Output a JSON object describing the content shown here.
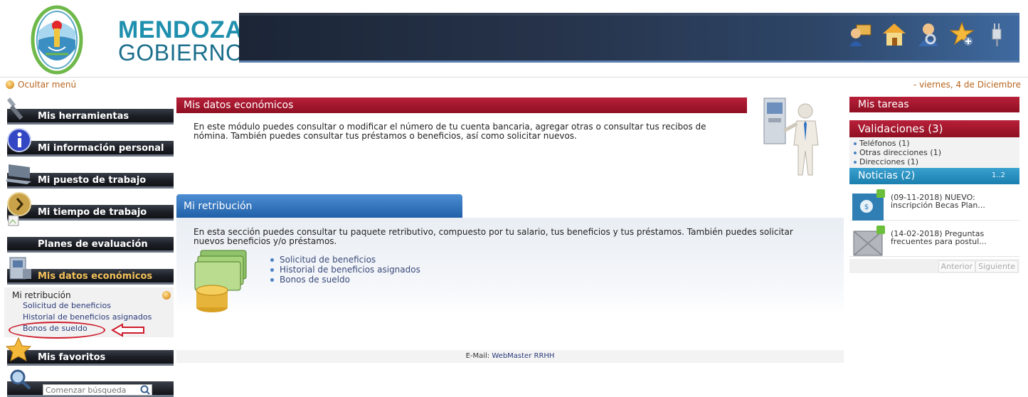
{
  "header": {
    "logo_line1": "MENDOZA",
    "logo_line2": "GOBIERNO",
    "icons": [
      "user-card-icon",
      "home-icon",
      "user-search-icon",
      "favorite-star-icon",
      "logout-plug-icon"
    ]
  },
  "topbar": {
    "hide_menu": "Ocultar menú",
    "date": "- viernes, 4 de Diciembre"
  },
  "sidebar": {
    "items": [
      {
        "label": "Mis herramientas",
        "icon": "wrench-icon"
      },
      {
        "label": "Mi información personal",
        "icon": "info-icon"
      },
      {
        "label": "Mi puesto de trabajo",
        "icon": "laptop-icon"
      },
      {
        "label": "Mi tiempo de trabajo",
        "icon": "clock-icon"
      },
      {
        "label": "Planes de evaluación",
        "icon": "broken-image-icon"
      },
      {
        "label": "Mis datos económicos",
        "icon": "atm-icon"
      }
    ],
    "submenu": {
      "head": "Mi retribución",
      "links": [
        "Solicitud de beneficios",
        "Historial de beneficios asignados",
        "Bonos de sueldo"
      ]
    },
    "favorites": "Mis favoritos",
    "search_placeholder": "Comenzar búsqueda"
  },
  "main": {
    "title": "Mis datos económicos",
    "intro_line1": "En este módulo puedes consultar o modificar el número de tu cuenta bancaria, agregar otras o consultar tus recibos de",
    "intro_line2": "nómina. También puedes consultar tus préstamos o beneficios, así como solicitar nuevos.",
    "retribution": {
      "tab": "Mi retribución",
      "text_line1": "En esta sección puedes consultar tu paquete retributivo, compuesto por tu salario, tus beneficios y tus préstamos. También puedes solicitar",
      "text_line2": "nuevos beneficios y/o préstamos.",
      "links": [
        "Solicitud de beneficios",
        "Historial de beneficios asignados",
        "Bonos de sueldo"
      ]
    },
    "footer": {
      "label": "E-Mail:",
      "link1": "WebMaster",
      "link2": "RRHH"
    }
  },
  "right": {
    "tasks_title": "Mis tareas",
    "validations_title": "Validaciones (3)",
    "validations": [
      "Teléfonos (1)",
      "Otras direcciones (1)",
      "Direcciones (1)"
    ],
    "news_title": "Noticias (2)",
    "news_pages": "1..2",
    "news": [
      {
        "line1": "(09-11-2018) NUEVO:",
        "line2": "inscripción Becas Plan..."
      },
      {
        "line1": "(14-02-2018) Preguntas",
        "line2": "frecuentes para postul..."
      }
    ],
    "prev": "Anterior",
    "next": "Siguiente"
  },
  "colors": {
    "title_red": "#a5162e",
    "nav_blue": "#2060a8",
    "news_blue": "#1a7fae",
    "link": "#2a3a7a",
    "annotation_red": "#cf1b2b"
  }
}
